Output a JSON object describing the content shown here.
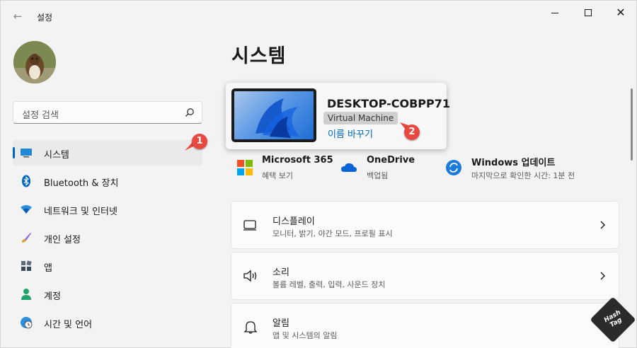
{
  "window": {
    "title": "설정"
  },
  "search": {
    "placeholder": "설정 검색"
  },
  "sidebar": {
    "items": [
      {
        "label": "시스템"
      },
      {
        "label": "Bluetooth & 장치"
      },
      {
        "label": "네트워크 및 인터넷"
      },
      {
        "label": "개인 설정"
      },
      {
        "label": "앱"
      },
      {
        "label": "계정"
      },
      {
        "label": "시간 및 언어"
      }
    ]
  },
  "page": {
    "title": "시스템"
  },
  "device": {
    "name": "DESKTOP-COBPP71",
    "model": "Virtual Machine",
    "rename": "이름 바꾸기"
  },
  "annotations": {
    "one": "1",
    "two": "2"
  },
  "quick_links": [
    {
      "title": "Microsoft 365",
      "sub": "혜택 보기"
    },
    {
      "title": "OneDrive",
      "sub": "백업됨"
    },
    {
      "title": "Windows 업데이트",
      "sub": "마지막으로 확인한 시간: 1분 전"
    }
  ],
  "settings": [
    {
      "title": "디스플레이",
      "sub": "모니터, 밝기, 야간 모드, 프로필 표시"
    },
    {
      "title": "소리",
      "sub": "볼륨 레벨, 출력, 입력, 사운드 장치"
    },
    {
      "title": "알림",
      "sub": "앱 및 시스템의 알림"
    }
  ],
  "watermark": {
    "text": "Hash Tag"
  },
  "colors": {
    "accent": "#0067c0",
    "badge": "#e8483f"
  }
}
